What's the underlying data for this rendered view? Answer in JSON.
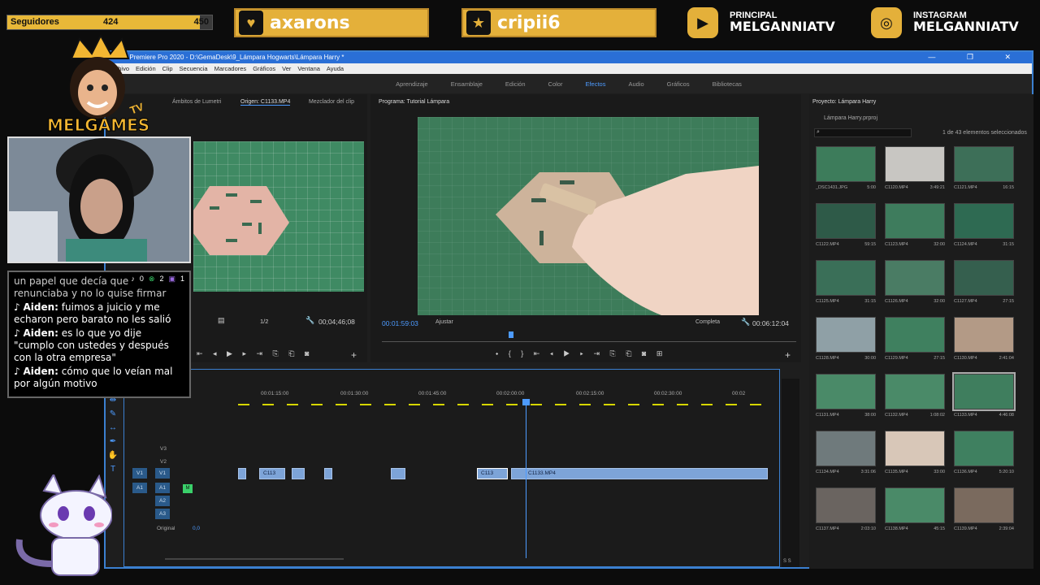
{
  "overlay": {
    "followers": {
      "label": "Seguidores",
      "current": "424",
      "goal": "450",
      "progress": 0.94
    },
    "social": [
      {
        "icon": "heart-icon",
        "name": "axarons"
      },
      {
        "icon": "star-icon",
        "name": "cripii6"
      }
    ],
    "youtube": {
      "icon": "youtube-icon",
      "small": "PRINCIPAL",
      "name": "MELGANNIATV"
    },
    "instagram": {
      "icon": "instagram-icon",
      "small": "INSTAGRAM",
      "name": "MELGANNIATV"
    },
    "logo": "MELGAMES",
    "logo_tv": "TV",
    "chat": {
      "counts": {
        "tiktok": "0",
        "xbox": "2",
        "twitch": "1"
      },
      "messages": [
        {
          "user": "",
          "text": "un papel que decía que renunciaba y no lo quise firmar"
        },
        {
          "user": "Aiden:",
          "text": "fuimos a juicio y me echaron pero barato no les salió"
        },
        {
          "user": "Aiden:",
          "text": "es lo que yo dije \"cumplo con ustedes y después con la otra empresa\""
        },
        {
          "user": "Aiden:",
          "text": "cómo que lo veían mal por algún motivo"
        }
      ]
    }
  },
  "app": {
    "title": "Adobe Premiere Pro 2020 - D:\\GemaDesk\\9_Lámpara Hogwarts\\Lámpara Harry *",
    "menu": [
      "Archivo",
      "Edición",
      "Clip",
      "Secuencia",
      "Marcadores",
      "Gráficos",
      "Ver",
      "Ventana",
      "Ayuda"
    ],
    "workspaces": [
      "Aprendizaje",
      "Ensamblaje",
      "Edición",
      "Color",
      "Efectos",
      "Audio",
      "Gráficos",
      "Bibliotecas"
    ],
    "active_workspace": "Efectos",
    "source": {
      "tabs": [
        "Efectos",
        "Ámbitos de Lumetri",
        "Origen: C1133.MP4",
        "Mezclador del clip"
      ],
      "scale": "1/2",
      "duration": "00;04;46;08"
    },
    "program": {
      "title": "Programa: Tutorial Lámpara",
      "timecode": "00:01:59:03",
      "fit": "Ajustar",
      "quality": "Completa",
      "duration": "00:06:12:04"
    },
    "timeline": {
      "ruler": [
        "00:01:15:00",
        "00:01:30:00",
        "00:01:45:00",
        "00:02:00:00",
        "00:02:15:00",
        "00:02:30:00",
        "00:02"
      ],
      "tracks": [
        "V3",
        "V2",
        "V1",
        "A1",
        "A2",
        "A3"
      ],
      "original": "Original",
      "original_val": "0,0",
      "clip_short": "C113",
      "clip_mid": "C113",
      "clip_long": "C1133.MP4",
      "vu": "S  S"
    },
    "project": {
      "title": "Proyecto: Lámpara Harry",
      "file": "Lámpara Harry.prproj",
      "selection": "1 de 43 elementos seleccionados",
      "items": [
        {
          "name": "_DSC1431.JPG",
          "dur": "5:00"
        },
        {
          "name": "C1120.MP4",
          "dur": "3:49:21"
        },
        {
          "name": "C1121.MP4",
          "dur": "16:15"
        },
        {
          "name": "C1122.MP4",
          "dur": "59:15"
        },
        {
          "name": "C1123.MP4",
          "dur": "32:00"
        },
        {
          "name": "C1124.MP4",
          "dur": "31:15"
        },
        {
          "name": "C1125.MP4",
          "dur": "31:15"
        },
        {
          "name": "C1126.MP4",
          "dur": "32:00"
        },
        {
          "name": "C1127.MP4",
          "dur": "27:15"
        },
        {
          "name": "C1128.MP4",
          "dur": "30:00"
        },
        {
          "name": "C1129.MP4",
          "dur": "27:15"
        },
        {
          "name": "C1130.MP4",
          "dur": "2:41:04"
        },
        {
          "name": "C1131.MP4",
          "dur": "38:00"
        },
        {
          "name": "C1132.MP4",
          "dur": "1:08:02"
        },
        {
          "name": "C1133.MP4",
          "dur": "4:46:08"
        },
        {
          "name": "C1134.MP4",
          "dur": "3:31:06"
        },
        {
          "name": "C1135.MP4",
          "dur": "33:00"
        },
        {
          "name": "C1136.MP4",
          "dur": "5:20:10"
        },
        {
          "name": "C1137.MP4",
          "dur": "2:03:10"
        },
        {
          "name": "C1138.MP4",
          "dur": "45:15"
        },
        {
          "name": "C1139.MP4",
          "dur": "2:39:04"
        }
      ]
    }
  }
}
